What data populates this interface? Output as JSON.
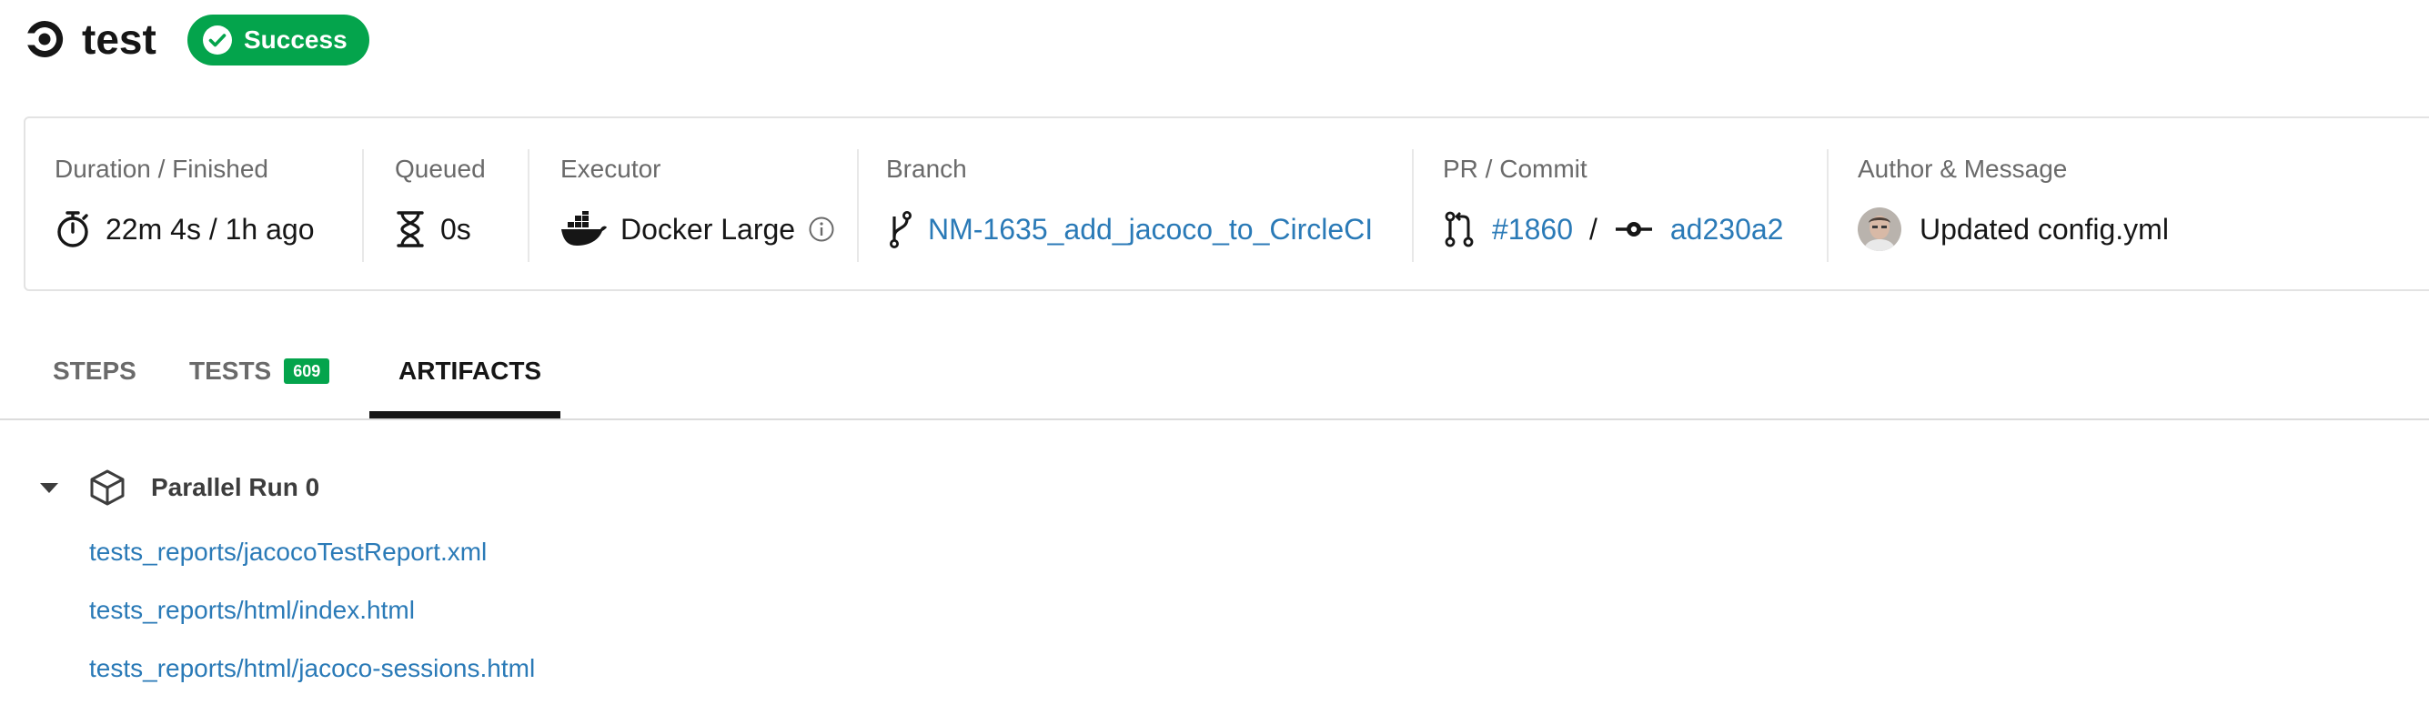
{
  "header": {
    "job_name": "test",
    "status": "Success"
  },
  "info": {
    "duration": {
      "label": "Duration / Finished",
      "value": "22m 4s / 1h ago"
    },
    "queued": {
      "label": "Queued",
      "value": "0s"
    },
    "executor": {
      "label": "Executor",
      "value": "Docker Large"
    },
    "branch": {
      "label": "Branch",
      "value": "NM-1635_add_jacoco_to_CircleCI"
    },
    "pr_commit": {
      "label": "PR / Commit",
      "pr": "#1860",
      "separator": "/",
      "commit": "ad230a2"
    },
    "author": {
      "label": "Author & Message",
      "message": "Updated config.yml"
    }
  },
  "tabs": [
    {
      "label": "STEPS",
      "active": false
    },
    {
      "label": "TESTS",
      "count": "609",
      "active": false
    },
    {
      "label": "ARTIFACTS",
      "active": true
    }
  ],
  "artifacts": {
    "group_title": "Parallel Run 0",
    "files": [
      "tests_reports/jacocoTestReport.xml",
      "tests_reports/html/index.html",
      "tests_reports/html/jacoco-sessions.html"
    ]
  },
  "icons": {
    "logo": "circleci-logo-icon",
    "status": "check-circle-icon",
    "duration": "stopwatch-icon",
    "queued": "hourglass-icon",
    "executor": "docker-icon",
    "executor_info": "info-icon",
    "branch": "git-branch-icon",
    "pr": "pull-request-icon",
    "commit": "commit-icon",
    "author": "avatar",
    "group_toggle": "caret-down-icon",
    "group": "package-box-icon"
  },
  "colors": {
    "success": "#04a44c",
    "link": "#2a7ab7",
    "text": "#161616",
    "muted": "#6a6a6a"
  }
}
